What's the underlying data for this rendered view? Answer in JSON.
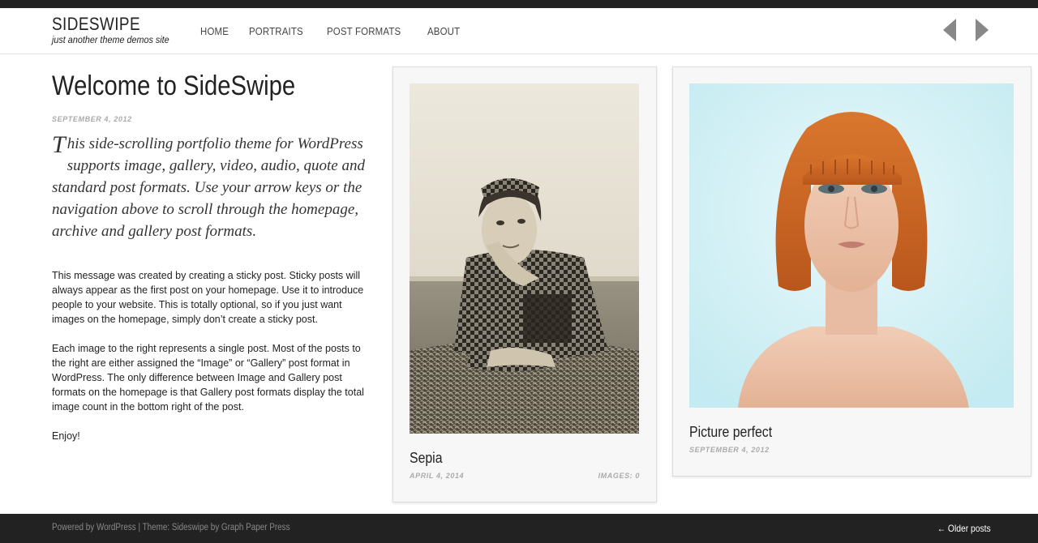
{
  "header": {
    "site_title": "SIDESWIPE",
    "tagline": "just another theme demos site",
    "nav": [
      {
        "label": "HOME"
      },
      {
        "label": "PORTRAITS"
      },
      {
        "label": "POST FORMATS"
      },
      {
        "label": "ABOUT"
      }
    ],
    "prev_icon": "arrow-left-icon",
    "next_icon": "arrow-right-icon"
  },
  "intro": {
    "title": "Welcome to SideSwipe",
    "date": "SEPTEMBER 4, 2012",
    "lead_dropcap": "T",
    "lead_rest": "his side-scrolling portfolio theme for WordPress supports image, gallery, video, audio, quote and standard post formats. Use your arrow keys or the navigation above to scroll through the homepage, archive and gallery post formats.",
    "body": [
      "This message was created by creating a sticky post. Sticky posts will always appear as the first post on your homepage. Use it to introduce people to your website. This is totally optional, so if you just want images on the homepage, simply don’t create a sticky post.",
      "Each image to the right represents a single post. Most of the posts to the right are either assigned the “Image” or “Gallery” post format in WordPress. The only difference between Image and Gallery post formats on the homepage is that Gallery post formats display the total image count in the bottom right of the post.",
      "Enjoy!"
    ]
  },
  "posts": [
    {
      "title": "Sepia",
      "date": "APRIL 4, 2014",
      "image_count": "IMAGES: 0"
    },
    {
      "title": "Picture perfect",
      "date": "SEPTEMBER 4, 2012"
    }
  ],
  "footer": {
    "powered": "Powered by WordPress",
    "separator": " | ",
    "theme": "Theme: Sideswipe by Graph Paper Press",
    "older_posts": "← Older posts"
  },
  "colors": {
    "bar": "#222222",
    "card_bg": "#f7f7f7",
    "meta_gray": "#aaaaaa"
  }
}
